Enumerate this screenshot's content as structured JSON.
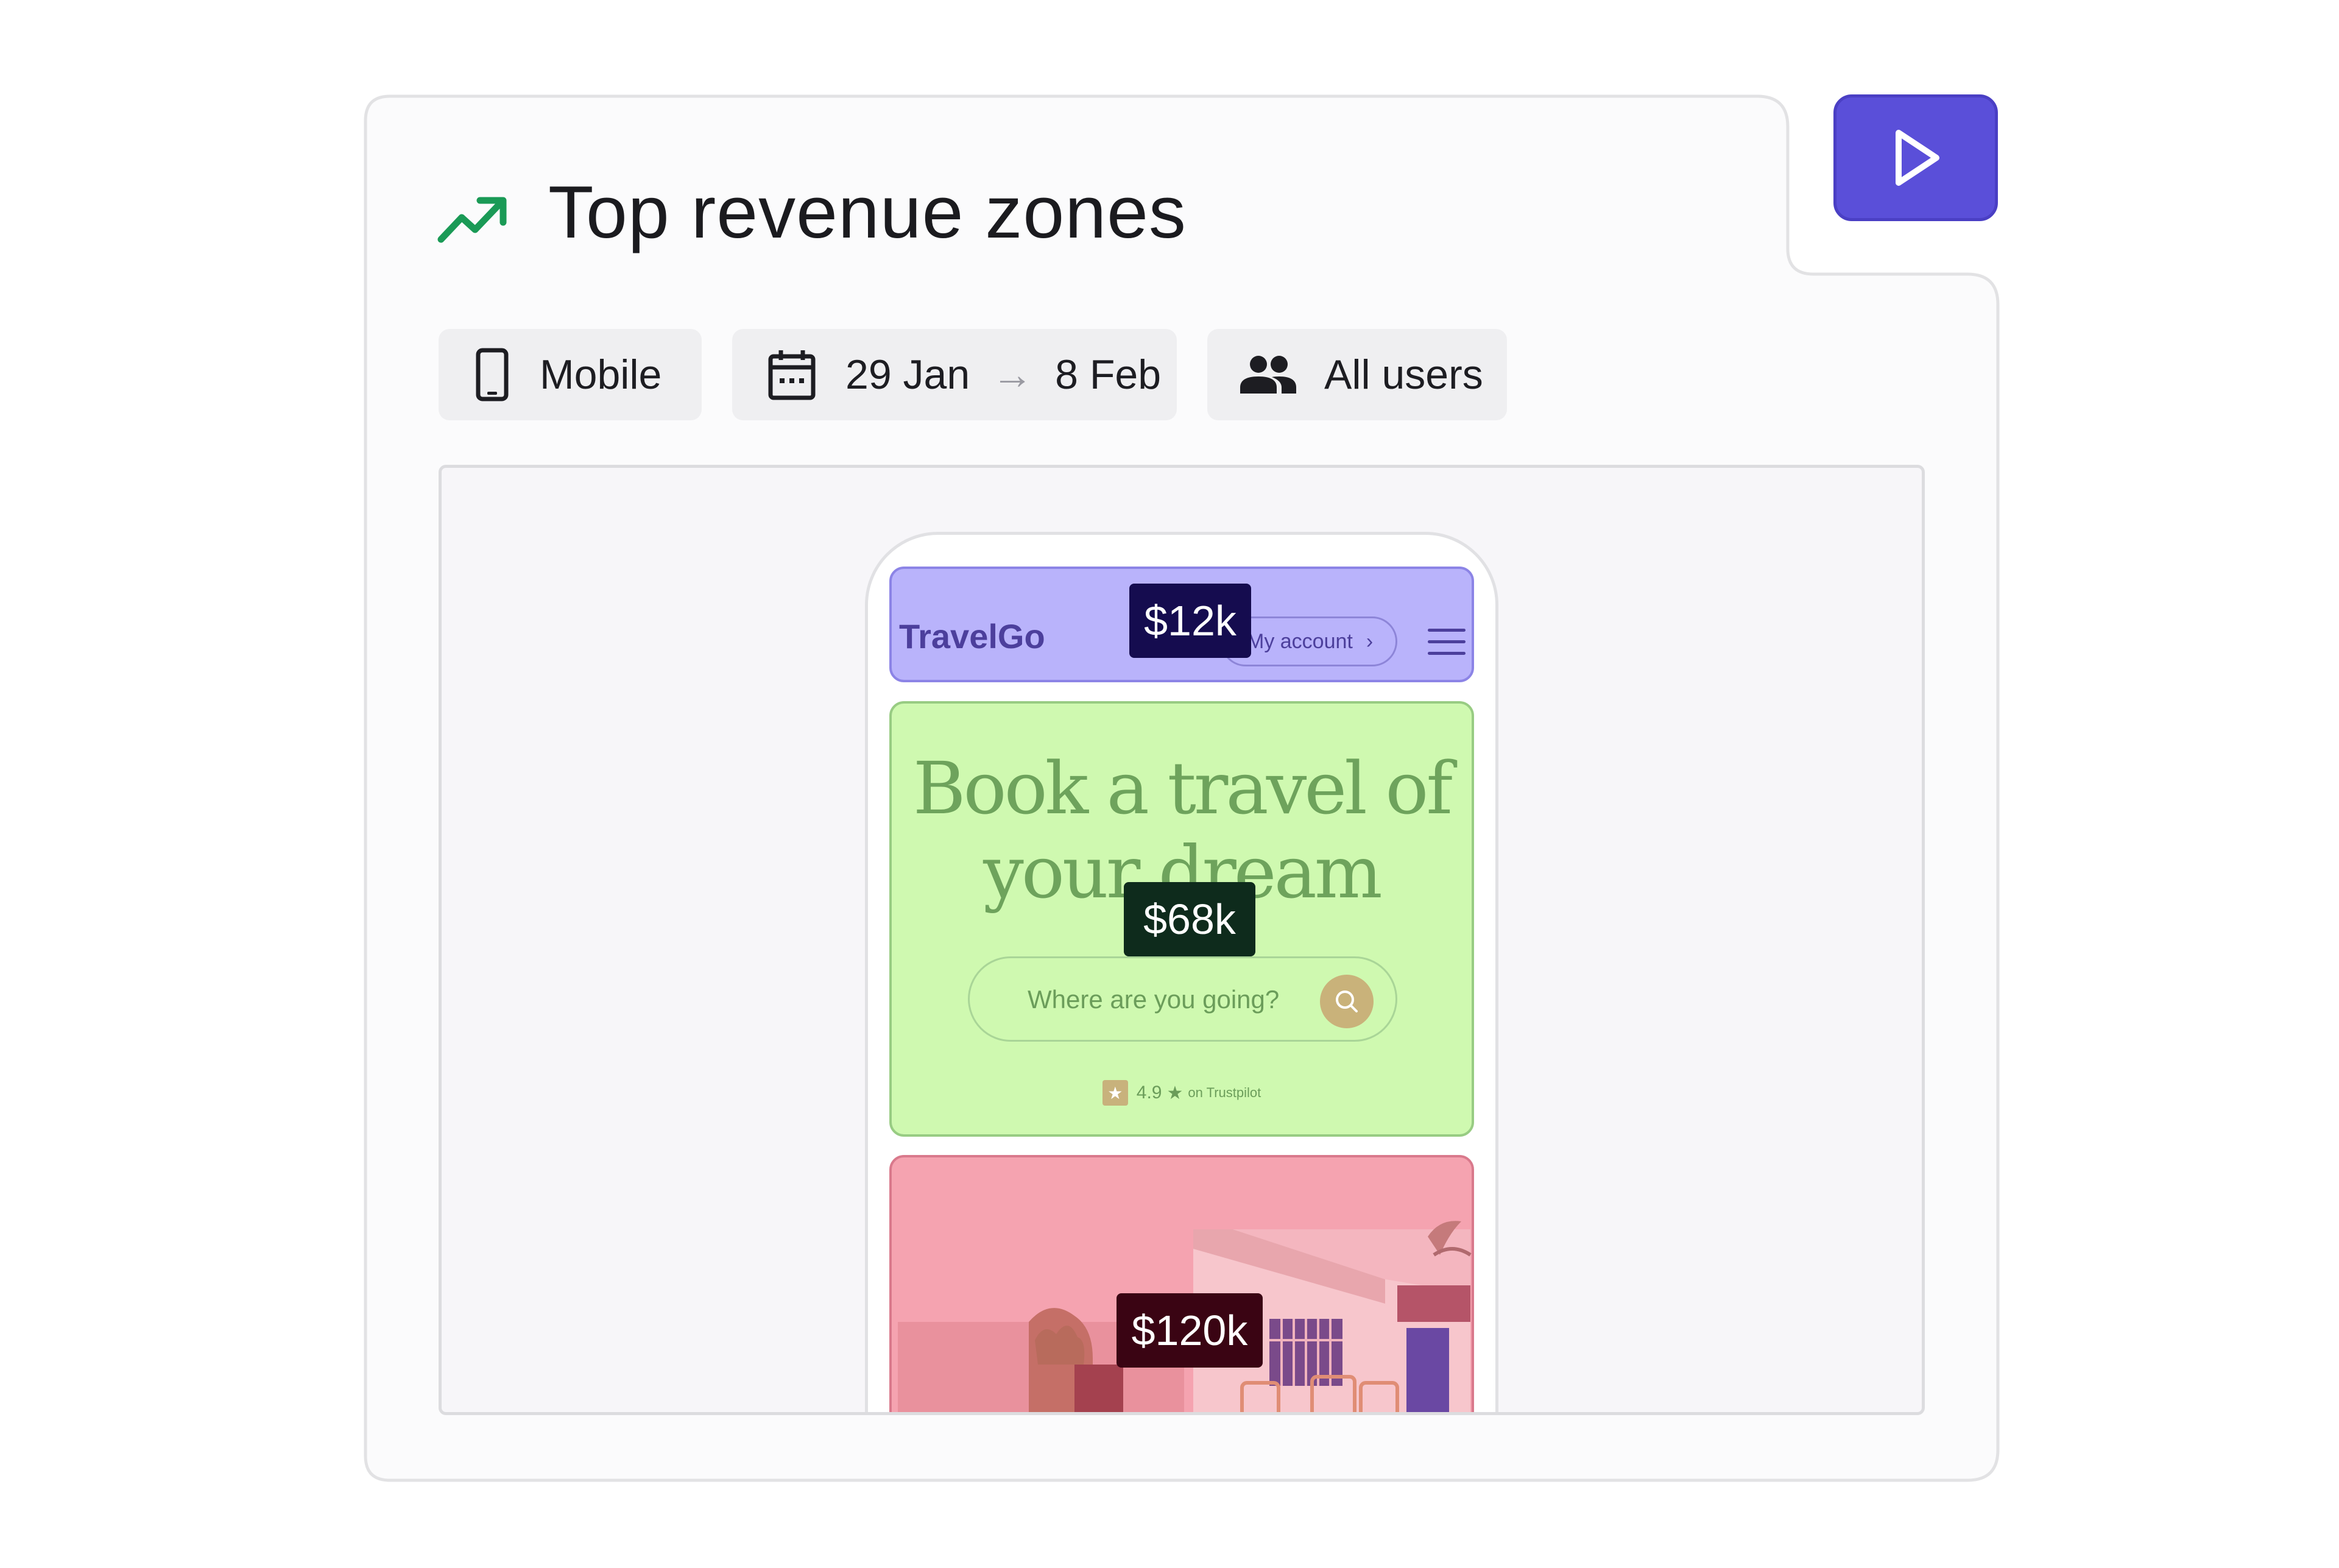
{
  "panel": {
    "title": "Top revenue zones",
    "title_icon": "trending-up-icon",
    "accent_color": "#1a9a56",
    "play_button_color": "#5a4fd9"
  },
  "filters": {
    "device": {
      "label": "Mobile",
      "icon": "mobile-phone-icon"
    },
    "date_range": {
      "start": "29 Jan",
      "arrow": "→",
      "end": "8 Feb",
      "icon": "calendar-icon"
    },
    "audience": {
      "label": "All users",
      "icon": "users-icon"
    }
  },
  "site_preview": {
    "brand": "TravelGo",
    "account_link": "My account",
    "account_chevron": "›",
    "hero_title": "Book a travel of your dream",
    "search_placeholder": "Where are you going?",
    "rating": {
      "score": "4.9",
      "star": "★",
      "suffix": "on Trustpilot",
      "tp_icon": "★"
    }
  },
  "zones": {
    "header": {
      "revenue": "$12k",
      "color": "#b9b3fb"
    },
    "hero": {
      "revenue": "$68k",
      "color": "#cff9b0"
    },
    "image": {
      "revenue": "$120k",
      "color": "#f5a3b0"
    }
  }
}
